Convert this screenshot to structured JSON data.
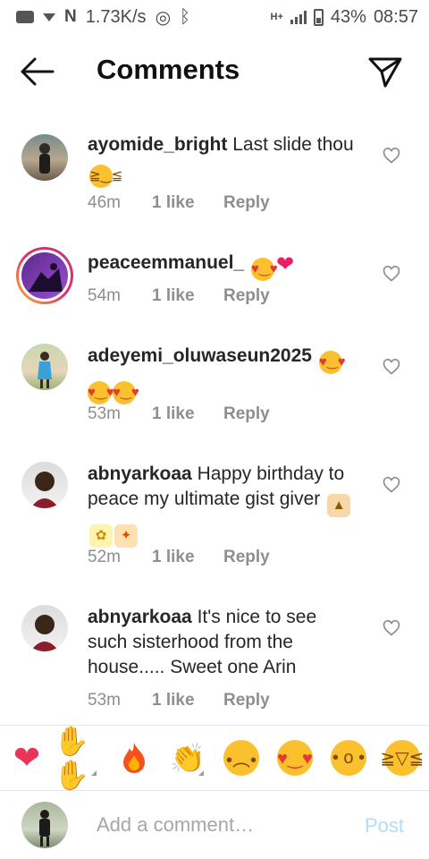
{
  "status_bar": {
    "speed": "1.73K/s",
    "network_label": "H+",
    "battery": "43%",
    "time": "08:57"
  },
  "header": {
    "title": "Comments",
    "back_icon": "back-arrow-icon",
    "share_icon": "paper-plane-icon"
  },
  "comments": [
    {
      "username": "ayomide_bright",
      "text": "Last slide thou",
      "emojis": [
        "grinning-squint"
      ],
      "time": "46m",
      "likes": "1 like",
      "reply": "Reply"
    },
    {
      "username": "peaceemmanuel_",
      "text": "",
      "emojis": [
        "heart-eyes",
        "pink-heart"
      ],
      "time": "54m",
      "likes": "1 like",
      "reply": "Reply",
      "has_story_ring": true
    },
    {
      "username": "adeyemi_oluwaseun2025",
      "text": "",
      "emojis": [
        "heart-eyes",
        "heart-eyes",
        "heart-eyes"
      ],
      "time": "53m",
      "likes": "1 like",
      "reply": "Reply"
    },
    {
      "username": "abnyarkoaa",
      "text": "Happy birthday to peace my ultimate gist giver",
      "emojis": [
        "birthday-cake",
        "bouquet",
        "confetti-ball"
      ],
      "time": "52m",
      "likes": "1 like",
      "reply": "Reply"
    },
    {
      "username": "abnyarkoaa",
      "text": "It's nice to see such sisterhood from the house..... Sweet one Arin",
      "emojis": [],
      "time": "53m",
      "likes": "1 like",
      "reply": "Reply"
    }
  ],
  "quick_reactions": [
    "red-heart",
    "raising-hands",
    "fire",
    "clapping-hands",
    "sad-face",
    "heart-eyes",
    "surprised-face",
    "grinning-squint"
  ],
  "composer": {
    "placeholder": "Add a comment…",
    "value": "",
    "post_label": "Post",
    "post_color": "#b3dbff"
  },
  "colors": {
    "username": "#262626",
    "meta": "#8e8e8e",
    "accent": "#0095f6"
  }
}
